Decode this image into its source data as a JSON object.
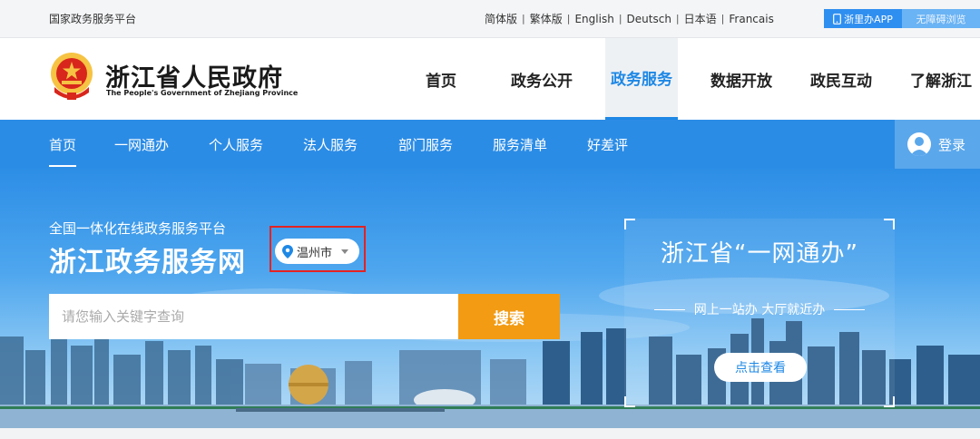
{
  "topbar": {
    "brand": "国家政务服务平台",
    "languages": [
      "简体版",
      "繁体版",
      "English",
      "Deutsch",
      "日本语",
      "Francais"
    ],
    "app_label": "浙里办APP",
    "accessibility_label": "无障碍浏览"
  },
  "header": {
    "logo_cn": "浙江省人民政府",
    "logo_en": "The People's Government of Zhejiang Province",
    "nav": [
      "首页",
      "政务公开",
      "政务服务",
      "数据开放",
      "政民互动",
      "了解浙江"
    ],
    "active_nav": "政务服务"
  },
  "subnav": {
    "items": [
      "首页",
      "一网通办",
      "个人服务",
      "法人服务",
      "部门服务",
      "服务清单",
      "好差评"
    ],
    "active": "首页",
    "login_label": "登录"
  },
  "hero": {
    "subtitle": "全国一体化在线政务服务平台",
    "title": "浙江政务服务网",
    "location": "温州市",
    "search_placeholder": "请您输入关键字查询",
    "search_button": "搜索"
  },
  "promo": {
    "title": "浙江省“一网通办”",
    "slogan": "网上一站办 大厅就近办",
    "button": "点击查看"
  },
  "colors": {
    "primary_blue": "#2b8ce6",
    "active_blue": "#1e88e5",
    "search_orange": "#f29b13",
    "highlight_red": "#e52222"
  }
}
